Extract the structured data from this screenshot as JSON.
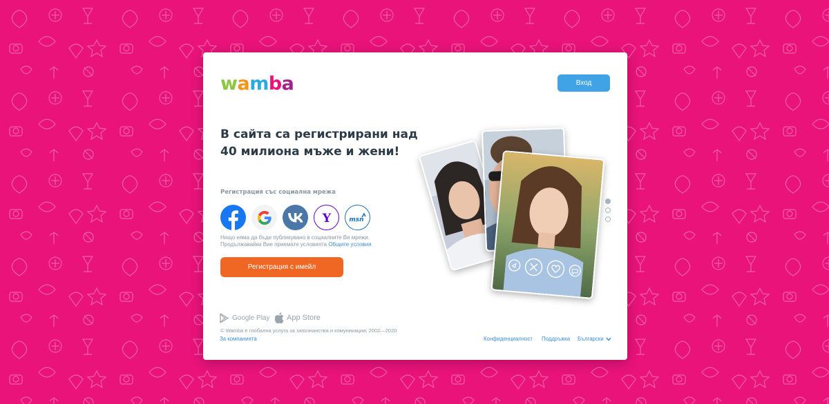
{
  "brand": {
    "logo_letters": [
      {
        "char": "w",
        "color": "#8dc63f"
      },
      {
        "char": "a",
        "color": "#f7941d"
      },
      {
        "char": "m",
        "color": "#29abe2"
      },
      {
        "char": "b",
        "color": "#e9137a"
      },
      {
        "char": "a",
        "color": "#a3238e"
      }
    ],
    "background_color": "#e9137a"
  },
  "header": {
    "login_label": "Вход"
  },
  "hero": {
    "headline": "В сайта са регистрирани над 40 милиона мъже и жени!"
  },
  "social": {
    "label": "Регистрация със социална мрежа",
    "providers": [
      {
        "name": "facebook",
        "icon": "facebook-icon"
      },
      {
        "name": "google",
        "icon": "google-icon"
      },
      {
        "name": "vkontakte",
        "icon": "vk-icon"
      },
      {
        "name": "yahoo",
        "icon": "yahoo-icon"
      },
      {
        "name": "msn",
        "icon": "msn-icon"
      }
    ],
    "disclaimer_text": "Нищо няма да бъде публикувано в социалните Ви мрежи. Продължавайки Вие приемате условията ",
    "terms_link": "Общите условия"
  },
  "register": {
    "email_button_label": "Регистрация с имейл"
  },
  "stores": {
    "google_play": "Google Play",
    "app_store": "App Store"
  },
  "footer": {
    "copyright": "© Wamba е глобална услуга за запознанства и комуникации; 2002—2020",
    "about_link": "За компанията",
    "privacy_link": "Конфиденциалност",
    "support_link": "Поддръжка",
    "language": "Български"
  },
  "carousel": {
    "slide_count": 3,
    "active_index": 0,
    "action_icons": [
      "boost-icon",
      "dislike-icon",
      "like-icon",
      "chat-icon"
    ]
  }
}
